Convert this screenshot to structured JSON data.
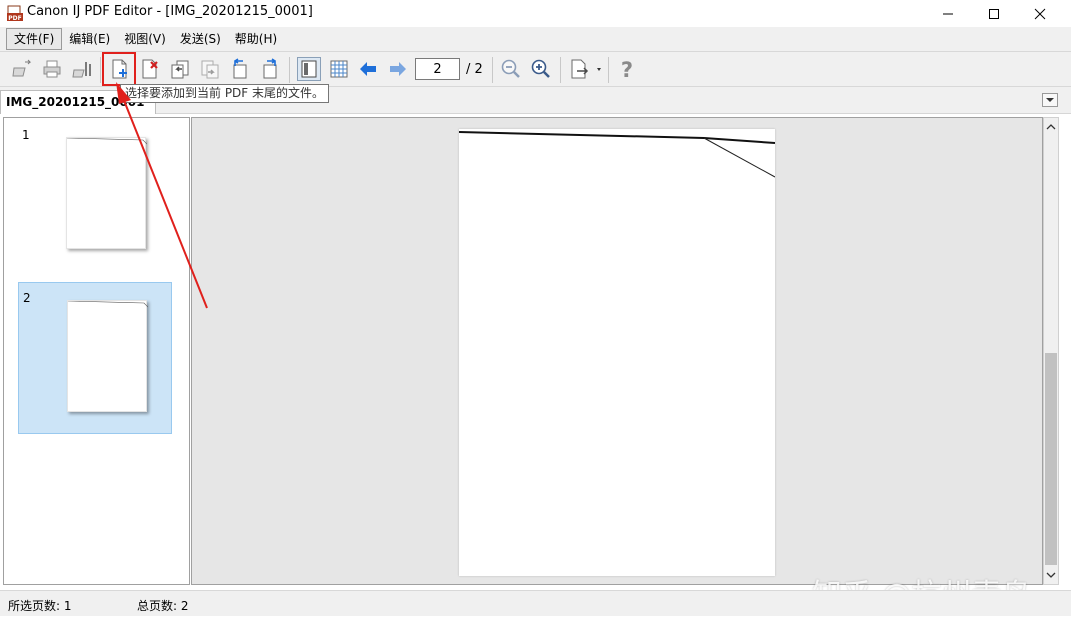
{
  "window": {
    "title": "Canon IJ PDF Editor - [IMG_20201215_0001]",
    "app_icon_text": "PDF"
  },
  "menu": [
    {
      "label": "文件(F)"
    },
    {
      "label": "编辑(E)"
    },
    {
      "label": "视图(V)"
    },
    {
      "label": "发送(S)"
    },
    {
      "label": "帮助(H)"
    }
  ],
  "toolbar": {
    "page_number": "2",
    "page_total": "/ 2",
    "tooltip": "选择要添加到当前 PDF 末尾的文件。",
    "icons": [
      "open-icon",
      "print-icon",
      "settings-icon",
      "add-page-icon",
      "delete-page-icon",
      "move-page-up-icon",
      "move-page-down-icon",
      "rotate-left-icon",
      "rotate-right-icon",
      "single-page-view-icon",
      "grid-view-icon",
      "previous-page-icon",
      "next-page-icon",
      "zoom-out-icon",
      "zoom-in-icon",
      "export-icon",
      "help-icon"
    ]
  },
  "document_tab": {
    "label": "IMG_20201215_0001"
  },
  "thumbnails": [
    {
      "number": "1",
      "selected": false
    },
    {
      "number": "2",
      "selected": true
    }
  ],
  "status": {
    "selected_pages": "所选页数: 1",
    "total_pages": "总页数: 2"
  },
  "watermark": "知乎 @杭州青鸟",
  "colors": {
    "selection": "#cce4f7",
    "annotation_red": "#e0201c",
    "nav_arrow_blue": "#1e6fd9"
  }
}
